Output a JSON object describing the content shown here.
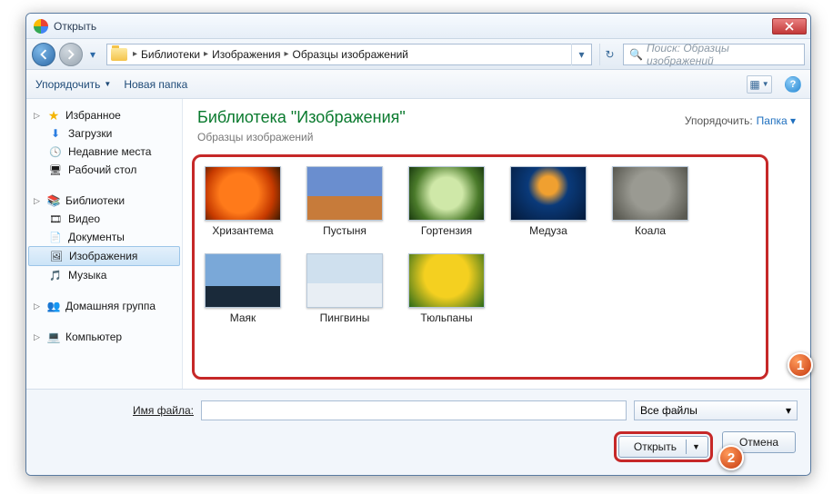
{
  "titlebar": {
    "title": "Открыть"
  },
  "nav": {
    "crumbs": [
      "Библиотеки",
      "Изображения",
      "Образцы изображений"
    ],
    "search_placeholder": "Поиск: Образцы изображений"
  },
  "toolbar": {
    "organize": "Упорядочить",
    "new_folder": "Новая папка"
  },
  "sidebar": {
    "favorites": {
      "label": "Избранное",
      "items": [
        {
          "icon": "dl",
          "label": "Загрузки"
        },
        {
          "icon": "recent",
          "label": "Недавние места"
        },
        {
          "icon": "desktop",
          "label": "Рабочий стол"
        }
      ]
    },
    "libraries": {
      "label": "Библиотеки",
      "items": [
        {
          "icon": "video",
          "label": "Видео"
        },
        {
          "icon": "doc",
          "label": "Документы"
        },
        {
          "icon": "img",
          "label": "Изображения",
          "selected": true
        },
        {
          "icon": "music",
          "label": "Музыка"
        }
      ]
    },
    "homegroup": {
      "label": "Домашняя группа"
    },
    "computer": {
      "label": "Компьютер"
    }
  },
  "main": {
    "library_title": "Библиотека \"Изображения\"",
    "subtitle": "Образцы изображений",
    "arrange_label": "Упорядочить:",
    "arrange_value": "Папка",
    "thumbs": [
      {
        "cls": "chrys",
        "label": "Хризантема"
      },
      {
        "cls": "desert",
        "label": "Пустыня"
      },
      {
        "cls": "hydra",
        "label": "Гортензия"
      },
      {
        "cls": "jelly",
        "label": "Медуза"
      },
      {
        "cls": "koala",
        "label": "Коала"
      },
      {
        "cls": "light",
        "label": "Маяк"
      },
      {
        "cls": "peng",
        "label": "Пингвины"
      },
      {
        "cls": "tulip",
        "label": "Тюльпаны"
      }
    ]
  },
  "bottom": {
    "filename_label": "Имя файла:",
    "filter_label": "Все файлы",
    "open_label": "Открыть",
    "cancel_label": "Отмена"
  },
  "callouts": {
    "one": "1",
    "two": "2"
  }
}
